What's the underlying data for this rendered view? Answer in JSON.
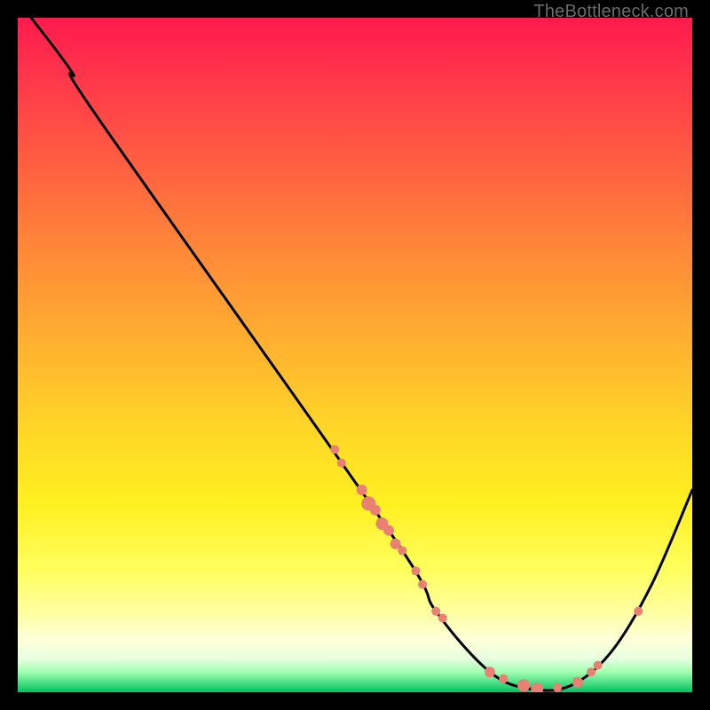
{
  "watermark": "TheBottleneck.com",
  "chart_data": {
    "type": "line",
    "title": "",
    "xlabel": "",
    "ylabel": "",
    "xlim": [
      0,
      100
    ],
    "ylim": [
      0,
      100
    ],
    "curve": [
      {
        "x": 2,
        "y": 100
      },
      {
        "x": 8,
        "y": 92
      },
      {
        "x": 12,
        "y": 85
      },
      {
        "x": 55,
        "y": 24
      },
      {
        "x": 62,
        "y": 12
      },
      {
        "x": 70,
        "y": 3
      },
      {
        "x": 76,
        "y": 0.5
      },
      {
        "x": 82,
        "y": 1
      },
      {
        "x": 88,
        "y": 6
      },
      {
        "x": 94,
        "y": 16
      },
      {
        "x": 100,
        "y": 30
      }
    ],
    "points": [
      {
        "x": 47,
        "y": 36,
        "r": 5
      },
      {
        "x": 48,
        "y": 34,
        "r": 5
      },
      {
        "x": 51,
        "y": 30,
        "r": 6
      },
      {
        "x": 52,
        "y": 28,
        "r": 8
      },
      {
        "x": 53,
        "y": 27,
        "r": 6
      },
      {
        "x": 54,
        "y": 25,
        "r": 7
      },
      {
        "x": 55,
        "y": 24,
        "r": 6
      },
      {
        "x": 56,
        "y": 22,
        "r": 6
      },
      {
        "x": 57,
        "y": 21,
        "r": 5
      },
      {
        "x": 59,
        "y": 18,
        "r": 5
      },
      {
        "x": 60,
        "y": 16,
        "r": 5
      },
      {
        "x": 62,
        "y": 12,
        "r": 5
      },
      {
        "x": 63,
        "y": 11,
        "r": 5
      },
      {
        "x": 70,
        "y": 3,
        "r": 6
      },
      {
        "x": 72,
        "y": 2,
        "r": 5
      },
      {
        "x": 75,
        "y": 1,
        "r": 7
      },
      {
        "x": 77,
        "y": 0.5,
        "r": 7
      },
      {
        "x": 80,
        "y": 0.7,
        "r": 5
      },
      {
        "x": 83,
        "y": 1.5,
        "r": 6
      },
      {
        "x": 85,
        "y": 3,
        "r": 5
      },
      {
        "x": 86,
        "y": 4,
        "r": 5
      },
      {
        "x": 92,
        "y": 12,
        "r": 5
      }
    ],
    "point_color": "#e98074",
    "curve_color": "#000000"
  }
}
